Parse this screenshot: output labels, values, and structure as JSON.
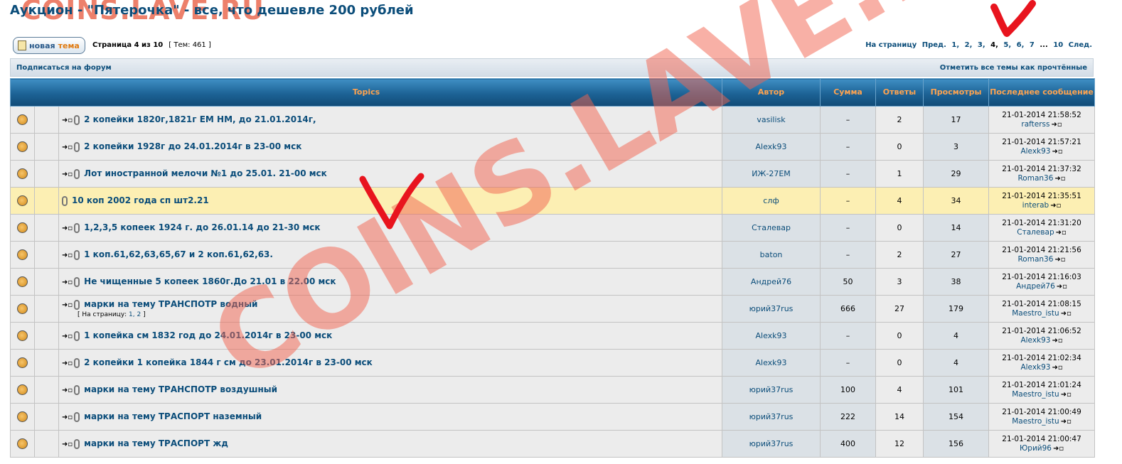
{
  "header": {
    "title": "Аукцион - \"Пятерочка\" - все, что дешевле 200 рублей",
    "watermark_top": "COINS.LAVE.RU",
    "watermark_big": "COINS.LAVE.RU"
  },
  "toolbar": {
    "new_topic_part1": "новая",
    "new_topic_part2": "тема",
    "page_info": "Страница 4 из 10",
    "topics_count": "[ Тем: 461 ]"
  },
  "pagination": {
    "prefix": "На страницу",
    "prev": "Пред.",
    "pages": [
      "1,",
      "2,",
      "3,",
      "4,",
      "5,",
      "6,",
      "7",
      "...",
      "10"
    ],
    "next": "След."
  },
  "forum_bar": {
    "subscribe": "Подписаться на форум",
    "mark_read": "Отметить все темы как прочтённые"
  },
  "columns": {
    "topics": "Topics",
    "author": "Автор",
    "sum": "Сумма",
    "replies": "Ответы",
    "views": "Просмотры",
    "last_post": "Последнее сообщение"
  },
  "rows": [
    {
      "title": "2 копейки 1820г,1821г ЕМ НМ, до 21.01.2014г,",
      "author": "vasilisk",
      "sum": "–",
      "replies": "2",
      "views": "17",
      "last_date": "21-01-2014 21:58:52",
      "last_user": "rafterss"
    },
    {
      "title": "2 копейки 1928г до 24.01.2014г в 23-00 мск",
      "author": "Alexk93",
      "sum": "–",
      "replies": "0",
      "views": "3",
      "last_date": "21-01-2014 21:57:21",
      "last_user": "Alexk93"
    },
    {
      "title": "Лот иностранной мелочи №1 до 25.01. 21-00 мск",
      "author": "ИЖ-27ЕМ",
      "sum": "–",
      "replies": "1",
      "views": "29",
      "last_date": "21-01-2014 21:37:32",
      "last_user": "Roman36"
    },
    {
      "title": "10 коп 2002 года сп шт2.21",
      "author": "слф",
      "sum": "–",
      "replies": "4",
      "views": "34",
      "last_date": "21-01-2014 21:35:51",
      "last_user": "interab"
    },
    {
      "title": "1,2,3,5 копеек 1924 г. до 26.01.14 до 21-30 мск",
      "author": "Сталевар",
      "sum": "–",
      "replies": "0",
      "views": "14",
      "last_date": "21-01-2014 21:31:20",
      "last_user": "Сталевар"
    },
    {
      "title": "1 коп.61,62,63,65,67 и 2 коп.61,62,63.",
      "author": "baton",
      "sum": "–",
      "replies": "2",
      "views": "27",
      "last_date": "21-01-2014 21:21:56",
      "last_user": "Roman36"
    },
    {
      "title": "Не чищенные 5 копеек 1860г.До 21.01 в 22.00 мск",
      "author": "Андрей76",
      "sum": "50",
      "replies": "3",
      "views": "38",
      "last_date": "21-01-2014 21:16:03",
      "last_user": "Андрей76"
    },
    {
      "title": "марки на тему ТРАНСПОТР водный",
      "pages_prefix": "[",
      "pages_label": "На страницу:",
      "pages_links": "1, 2",
      "pages_suffix": "]",
      "author": "юрий37rus",
      "sum": "666",
      "replies": "27",
      "views": "179",
      "last_date": "21-01-2014 21:08:15",
      "last_user": "Maestro_istu"
    },
    {
      "title": "1 копейка см 1832 год до 24.01.2014г в 23-00 мск",
      "author": "Alexk93",
      "sum": "–",
      "replies": "0",
      "views": "4",
      "last_date": "21-01-2014 21:06:52",
      "last_user": "Alexk93"
    },
    {
      "title": "2 копейки 1 копейка 1844 г см до 23.01.2014г в 23-00 мск",
      "author": "Alexk93",
      "sum": "–",
      "replies": "0",
      "views": "4",
      "last_date": "21-01-2014 21:02:34",
      "last_user": "Alexk93"
    },
    {
      "title": "марки на тему ТРАНСПОТР воздушный",
      "author": "юрий37rus",
      "sum": "100",
      "replies": "4",
      "views": "101",
      "last_date": "21-01-2014 21:01:24",
      "last_user": "Maestro_istu"
    },
    {
      "title": "марки на тему ТРАСПОРТ наземный",
      "author": "юрий37rus",
      "sum": "222",
      "replies": "14",
      "views": "154",
      "last_date": "21-01-2014 21:00:49",
      "last_user": "Maestro_istu"
    },
    {
      "title": "марки на тему ТРАСПОРТ жд",
      "author": "юрий37rus",
      "sum": "400",
      "replies": "12",
      "views": "156",
      "last_date": "21-01-2014 21:00:47",
      "last_user": "Юрий96"
    }
  ],
  "icons": {
    "topic": "topic-folder-icon",
    "moved": "arrow-to-page-icon",
    "attachment": "paperclip-icon",
    "view_last": "go-to-last-post-icon"
  },
  "colors": {
    "header_blue": "#1c6295",
    "header_text": "#ffa34f",
    "link": "#0b4d7a",
    "highlight_row": "#fcefb3",
    "watermark": "#f26450",
    "annotation": "#e8141e"
  }
}
